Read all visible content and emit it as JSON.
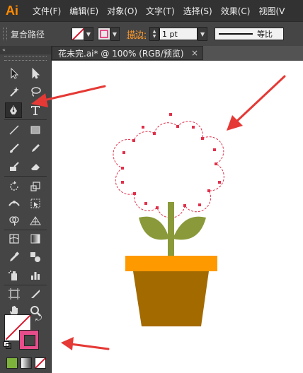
{
  "app": {
    "logo": "Ai"
  },
  "menubar": {
    "items": [
      "文件(F)",
      "编辑(E)",
      "对象(O)",
      "文字(T)",
      "选择(S)",
      "效果(C)",
      "视图(V"
    ]
  },
  "controlbar": {
    "path_label": "复合路径",
    "stroke_label": "描边:",
    "stroke_weight": "1 pt",
    "profile_label": "等比"
  },
  "document": {
    "tab_title": "花未完.ai* @ 100% (RGB/预览)",
    "close_glyph": "×"
  },
  "toolpanel": {
    "collapse_glyph": "«",
    "active_tool": "pen-tool"
  },
  "colors": {
    "flower_outline": "#e0304a",
    "stem": "#8a9a3a",
    "pot_rim": "#ff9900",
    "pot_body": "#a36a00",
    "stroke_swatch": "#e64d8a",
    "annotation_arrow": "#e53935"
  }
}
